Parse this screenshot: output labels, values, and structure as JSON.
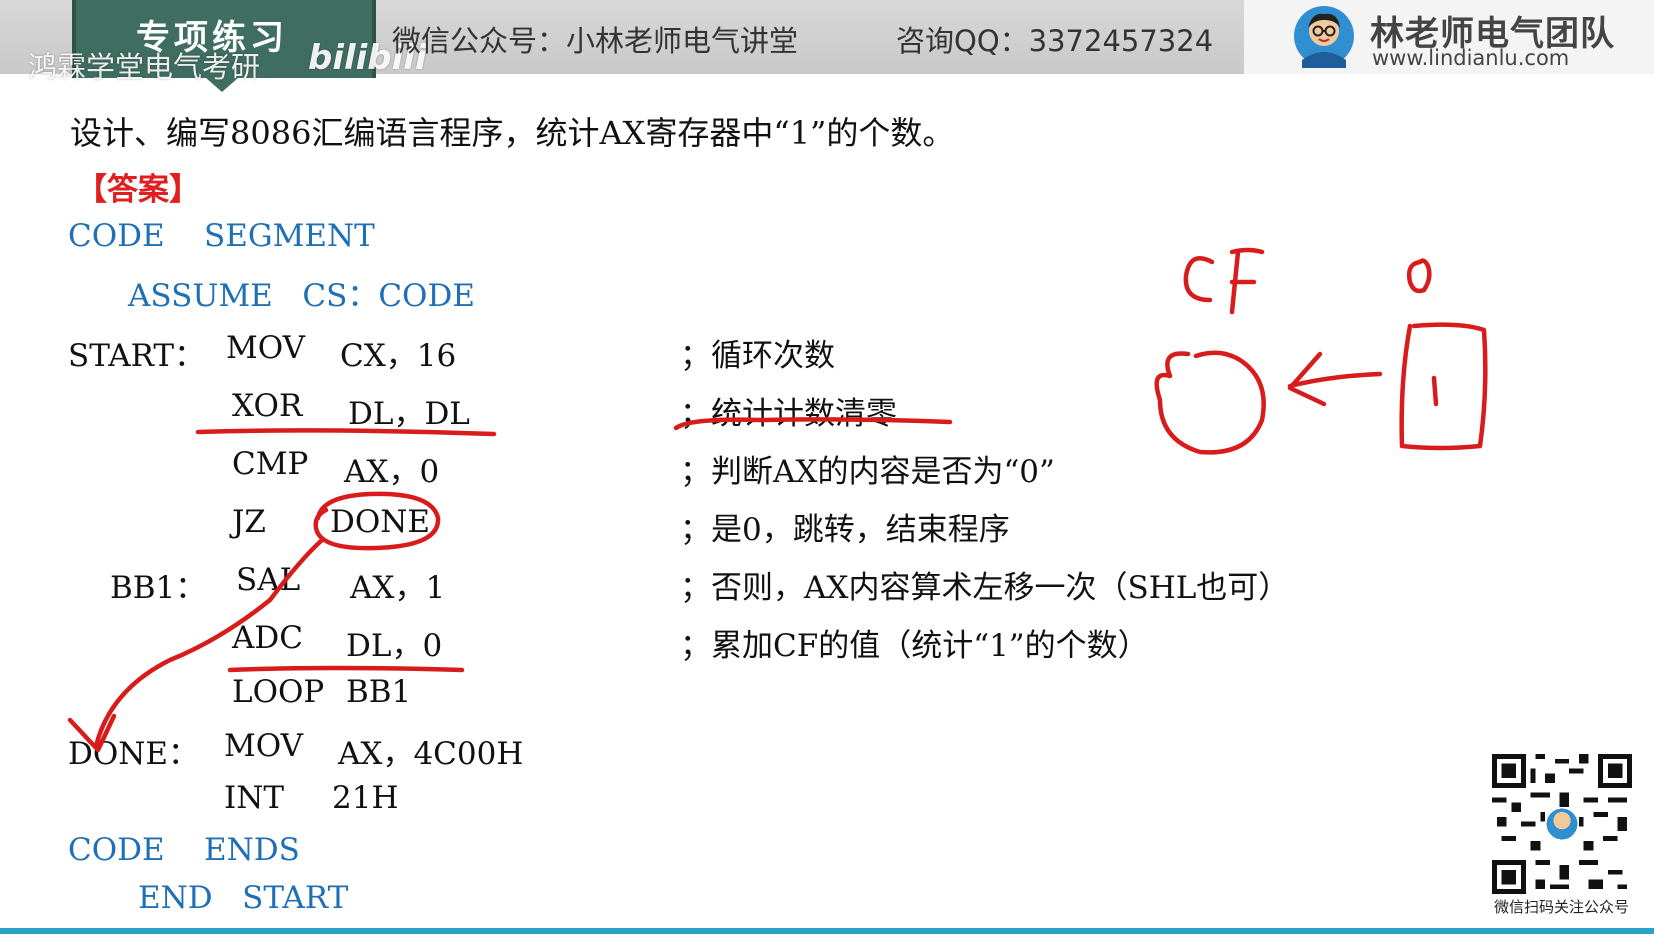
{
  "banner": {
    "tag": "专项练习",
    "watermark": "鸿霖学堂电气考研",
    "bilibili": "bilibili",
    "wechat": "微信公众号：小林老师电气讲堂",
    "qq": "咨询QQ：3372457324",
    "team_name": "林老师电气团队",
    "team_url": "www.lindianlu.com"
  },
  "question": "设计、编写8086汇编语言程序，统计AX寄存器中“1”的个数。",
  "answer_label": "【答案】",
  "code": {
    "code_segment": "CODE    SEGMENT",
    "assume": "ASSUME   CS：CODE",
    "start_label": "START：",
    "l1_op": "MOV",
    "l1_args": "CX，16",
    "l2_op": "XOR",
    "l2_args": "DL，DL",
    "l3_op": "CMP",
    "l3_args": "AX，0",
    "l4_op": "JZ",
    "l4_args": "DONE",
    "bb1_label": "BB1：",
    "l5_op": "SAL",
    "l5_args": "AX，1",
    "l6_op": "ADC",
    "l6_args": "DL，0",
    "l7_op": "LOOP",
    "l7_args": "BB1",
    "done_label": "DONE：",
    "l8_op": "MOV",
    "l8_args": "AX，4C00H",
    "l9_op": "INT",
    "l9_args": "21H",
    "code_ends": "CODE    ENDS",
    "end_start": "END   START"
  },
  "comments": {
    "c1": "；循环次数",
    "c2": "；统计计数清零",
    "c3": "；判断AX的内容是否为“0”",
    "c4": "；是0，跳转，结束程序",
    "c5": "；否则，AX内容算术左移一次（SHL也可）",
    "c6": "；累加CF的值（统计“1”的个数）"
  },
  "handwriting": {
    "cf": "CF",
    "zero": "0",
    "one": "1"
  },
  "qr_caption": "微信扫码关注公众号",
  "colors": {
    "code_blue": "#1f6fb6",
    "answer_red": "#e02020",
    "ink_red": "#d81c1c",
    "tag_green": "#3f6d5f",
    "bottom_line": "#2aa3c9"
  }
}
